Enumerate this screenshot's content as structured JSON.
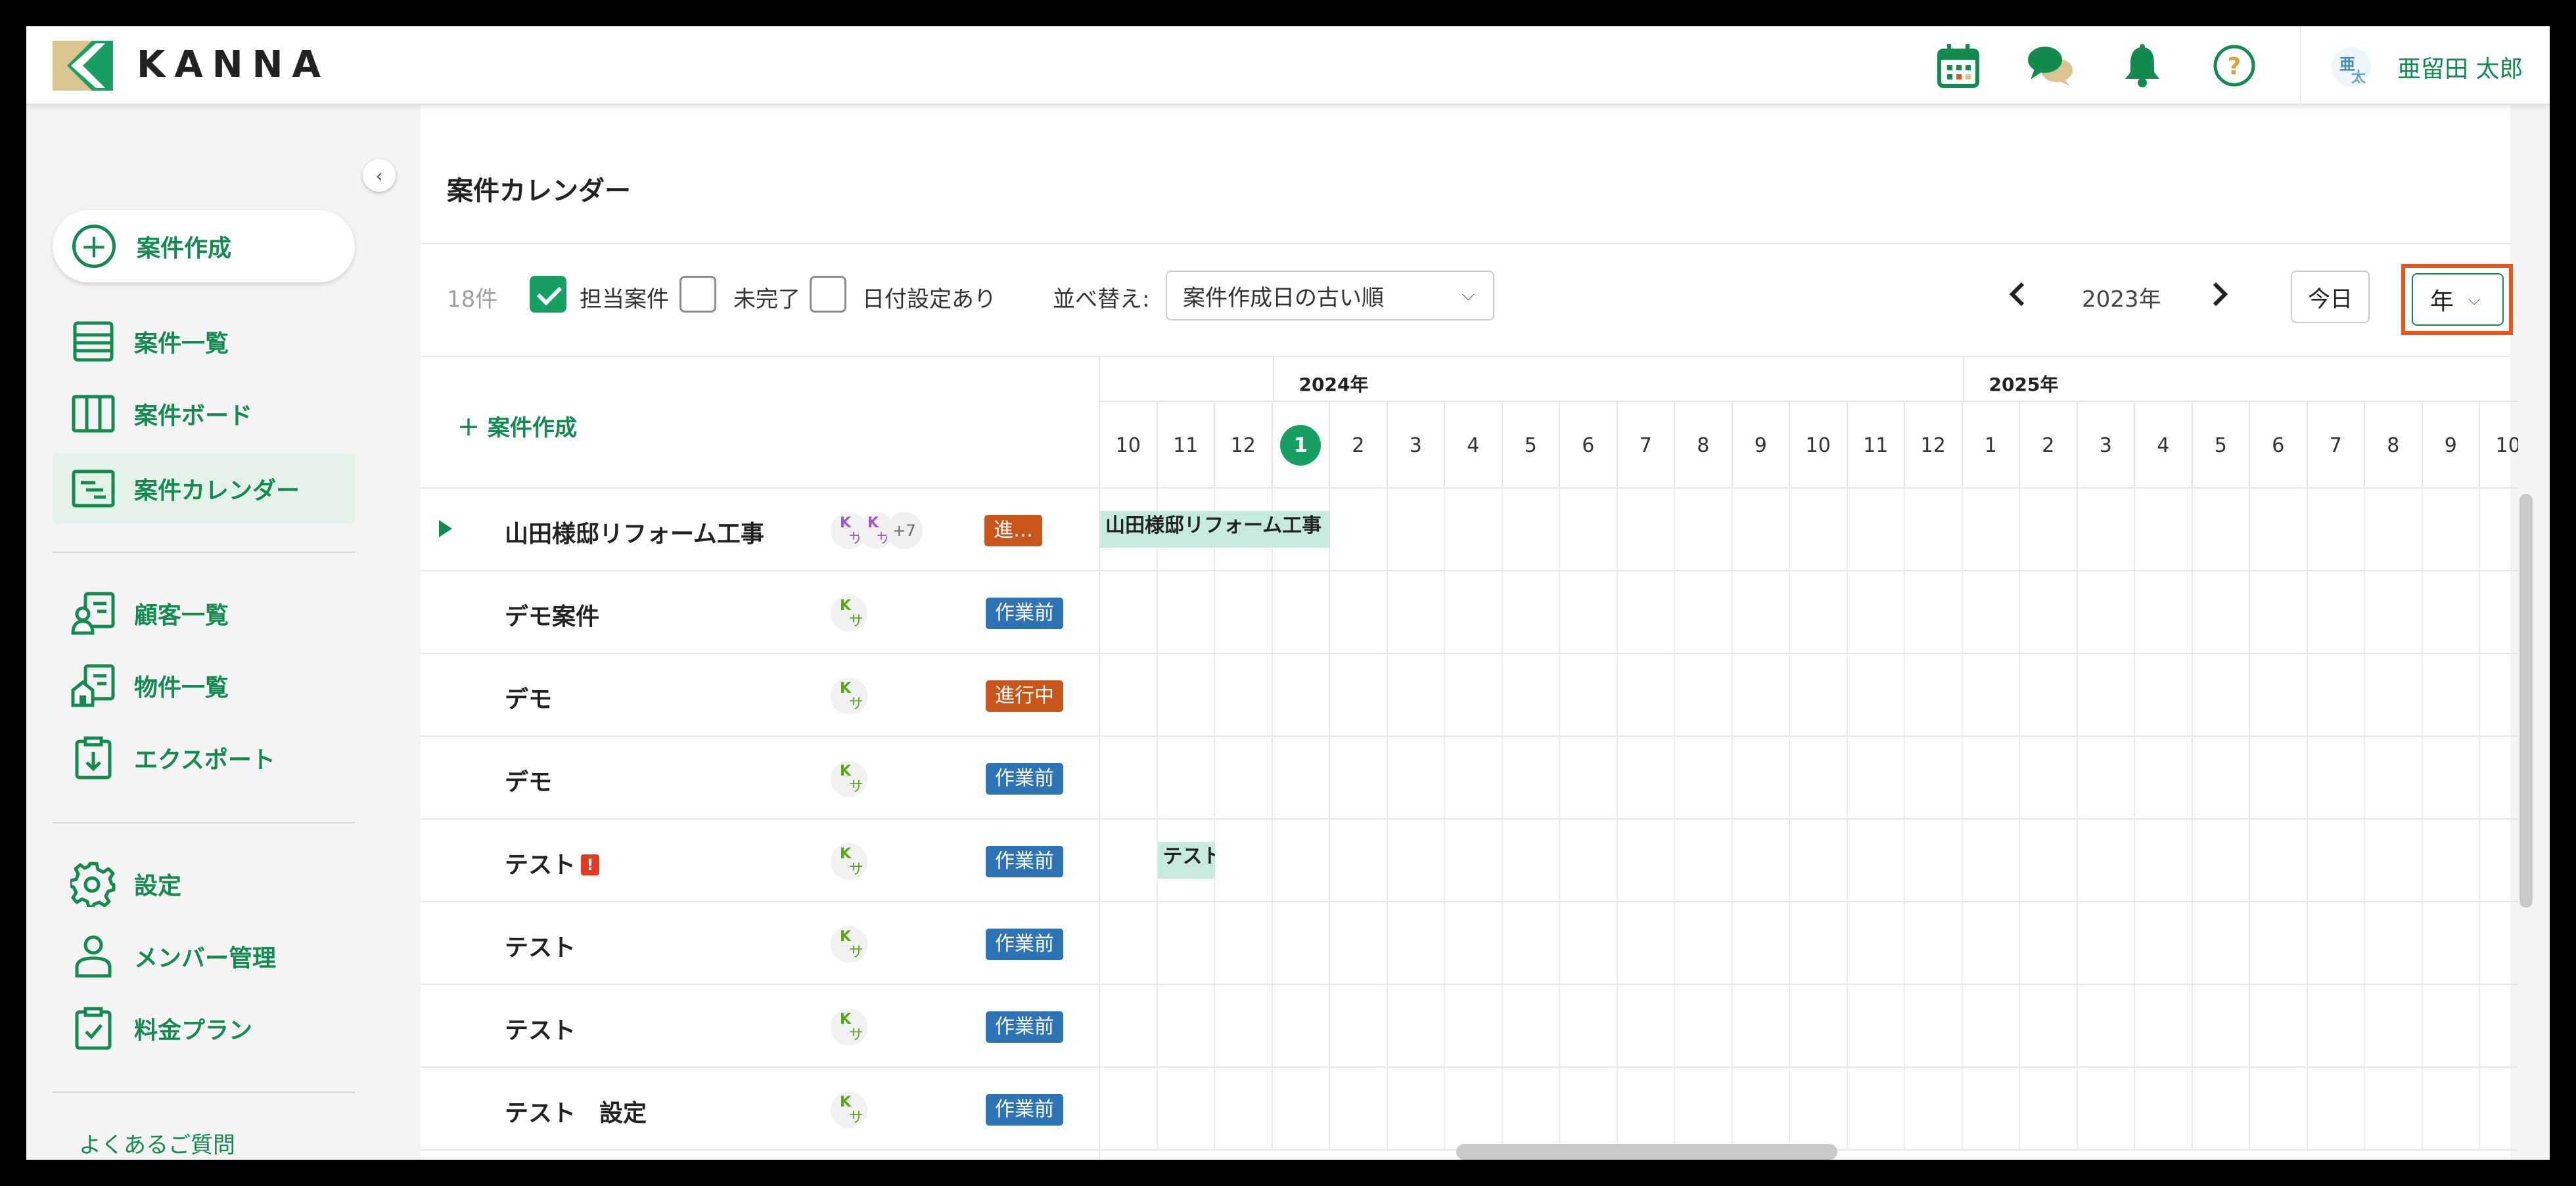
{
  "app": {
    "brand": "KANNA",
    "colors": {
      "accent": "#138a4f",
      "accent_bright": "#17a062",
      "highlight": "#e8541a",
      "status_blue": "#2e74b5",
      "status_orange": "#c8561b",
      "bar_fill": "#c6eadb"
    }
  },
  "header": {
    "icons": [
      "calendar-icon",
      "chat-icon",
      "bell-icon",
      "help-icon"
    ],
    "user": {
      "avatar_top": "亜",
      "avatar_bottom": "太",
      "name": "亜留田 太郎"
    }
  },
  "sidebar": {
    "create_label": "案件作成",
    "items": [
      {
        "label": "案件一覧",
        "icon": "list-icon"
      },
      {
        "label": "案件ボード",
        "icon": "board-icon"
      },
      {
        "label": "案件カレンダー",
        "icon": "calendar-list-icon",
        "active": true
      },
      {
        "label": "顧客一覧",
        "icon": "customer-icon"
      },
      {
        "label": "物件一覧",
        "icon": "property-icon"
      },
      {
        "label": "エクスポート",
        "icon": "export-icon"
      },
      {
        "label": "設定",
        "icon": "gear-icon"
      },
      {
        "label": "メンバー管理",
        "icon": "member-icon"
      },
      {
        "label": "料金プラン",
        "icon": "plan-icon"
      }
    ],
    "faq": "よくあるご質問"
  },
  "page": {
    "title": "案件カレンダー"
  },
  "toolbar": {
    "count": "18件",
    "filters": [
      {
        "label": "担当案件",
        "checked": true
      },
      {
        "label": "未完了",
        "checked": false
      },
      {
        "label": "日付設定あり",
        "checked": false
      }
    ],
    "sort_label": "並べ替え:",
    "sort_value": "案件作成日の古い順",
    "year": "2023年",
    "today": "今日",
    "view": "年"
  },
  "table": {
    "add_label": "案件作成",
    "years": [
      {
        "label": "2024年"
      },
      {
        "label": "2025年"
      }
    ],
    "months": [
      "10",
      "11",
      "12",
      "1",
      "2",
      "3",
      "4",
      "5",
      "6",
      "7",
      "8",
      "9",
      "10",
      "11",
      "12",
      "1",
      "2",
      "3",
      "4",
      "5",
      "6",
      "7",
      "8",
      "9",
      "10"
    ],
    "current_month_index": 3,
    "rows": [
      {
        "name": "山田様邸リフォーム工事",
        "status": "進…",
        "status_color": "orange",
        "expandable": true,
        "avatars": [
          "purple",
          "purple"
        ],
        "more": "+7",
        "bar": {
          "label": "山田様邸リフォーム工事",
          "start": "2023-10",
          "end": "2024-01"
        }
      },
      {
        "name": "デモ案件",
        "status": "作業前",
        "status_color": "blue",
        "avatars": [
          "green"
        ]
      },
      {
        "name": "デモ",
        "status": "進行中",
        "status_color": "orange",
        "avatars": [
          "green"
        ]
      },
      {
        "name": "デモ",
        "status": "作業前",
        "status_color": "blue",
        "avatars": [
          "green"
        ]
      },
      {
        "name": "テスト",
        "status": "作業前",
        "status_color": "blue",
        "avatars": [
          "green"
        ],
        "warning": "!",
        "bar": {
          "label": "テスト",
          "start": "2023-11",
          "end": "2023-11"
        }
      },
      {
        "name": "テスト",
        "status": "作業前",
        "status_color": "blue",
        "avatars": [
          "green"
        ]
      },
      {
        "name": "テスト",
        "status": "作業前",
        "status_color": "blue",
        "avatars": [
          "green"
        ]
      },
      {
        "name": "テスト　設定",
        "status": "作業前",
        "status_color": "blue",
        "avatars": [
          "green"
        ]
      }
    ],
    "avatar_text": {
      "k": "K",
      "s": "サ"
    }
  }
}
